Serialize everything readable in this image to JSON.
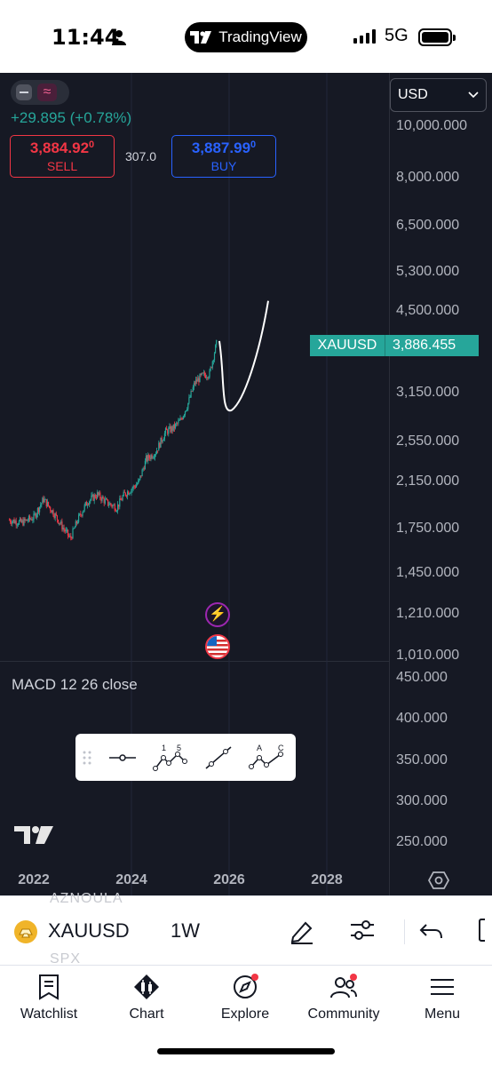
{
  "status_bar": {
    "time": "11:44",
    "app": "TradingView",
    "network": "5G"
  },
  "chart": {
    "currency": "USD",
    "change": "+29.895 (+0.78%)",
    "sell": {
      "price": "3,884.92",
      "price_sup": "0",
      "label": "SELL"
    },
    "buy": {
      "price": "3,887.99",
      "price_sup": "0",
      "label": "BUY"
    },
    "spread": "307.0",
    "ticker_tag": {
      "symbol": "XAUUSD",
      "price": "3,886.455"
    },
    "price_axis": [
      "10,000.000",
      "8,000.000",
      "6,500.000",
      "5,300.000",
      "4,500.000",
      "3,150.000",
      "2,550.000",
      "2,150.000",
      "1,750.000",
      "1,450.000",
      "1,210.000",
      "1,010.000"
    ],
    "macd_axis": [
      "450.000",
      "400.000",
      "350.000",
      "300.000",
      "250.000"
    ],
    "time_axis": [
      "2022",
      "2024",
      "2026",
      "2028"
    ],
    "macd_label": "MACD 12 26 close",
    "drawing_tools": [
      "line-tool",
      "elliott-impulse-tool",
      "trend-line-tool",
      "abc-correction-tool"
    ],
    "drawing_tool_labels": {
      "impulse_1": "1",
      "impulse_5": "5",
      "abc_a": "A",
      "abc_c": "C"
    },
    "colors": {
      "up": "#26a69a",
      "down": "#f23645",
      "background": "#161924"
    }
  },
  "chart_data": {
    "type": "candlestick",
    "title": "",
    "symbol": "XAUUSD",
    "interval": "1W",
    "scale": "log",
    "x_range": [
      "2021",
      "2028"
    ],
    "y_range": [
      1010,
      10000
    ],
    "x_ticks": [
      "2022",
      "2024",
      "2026",
      "2028"
    ],
    "y_ticks": [
      10000,
      8000,
      6500,
      5300,
      4500,
      3150,
      2550,
      2150,
      1750,
      1450,
      1210,
      1010
    ],
    "series": [
      {
        "type": "close",
        "values": [
          [
            "2021.5",
            1780
          ],
          [
            "2021.75",
            1760
          ],
          [
            "2022.0",
            1800
          ],
          [
            "2022.2",
            1950
          ],
          [
            "2022.4",
            1840
          ],
          [
            "2022.6",
            1720
          ],
          [
            "2022.75",
            1640
          ],
          [
            "2022.9",
            1780
          ],
          [
            "2023.1",
            1930
          ],
          [
            "2023.3",
            1990
          ],
          [
            "2023.5",
            1920
          ],
          [
            "2023.7",
            1880
          ],
          [
            "2023.85",
            1990
          ],
          [
            "2024.0",
            2040
          ],
          [
            "2024.15",
            2100
          ],
          [
            "2024.3",
            2320
          ],
          [
            "2024.5",
            2400
          ],
          [
            "2024.7",
            2620
          ],
          [
            "2024.85",
            2660
          ],
          [
            "2025.0",
            2750
          ],
          [
            "2025.15",
            2950
          ],
          [
            "2025.3",
            3250
          ],
          [
            "2025.45",
            3350
          ],
          [
            "2025.6",
            3380
          ],
          [
            "2025.75",
            3886
          ]
        ]
      }
    ],
    "annotations": [
      {
        "type": "projection-curve",
        "points": [
          [
            "2025.8",
            3900
          ],
          [
            "2026.05",
            2880
          ],
          [
            "2026.8",
            4650
          ]
        ]
      }
    ]
  },
  "symbol_bar": {
    "symbol": "XAUUSD",
    "interval": "1W",
    "ghost_top": "AZNOULA",
    "ghost_bottom": "SPX"
  },
  "tabs": [
    {
      "label": "Watchlist",
      "icon": "watchlist-icon"
    },
    {
      "label": "Chart",
      "icon": "chart-icon"
    },
    {
      "label": "Explore",
      "icon": "explore-icon"
    },
    {
      "label": "Community",
      "icon": "community-icon"
    },
    {
      "label": "Menu",
      "icon": "menu-icon"
    }
  ]
}
